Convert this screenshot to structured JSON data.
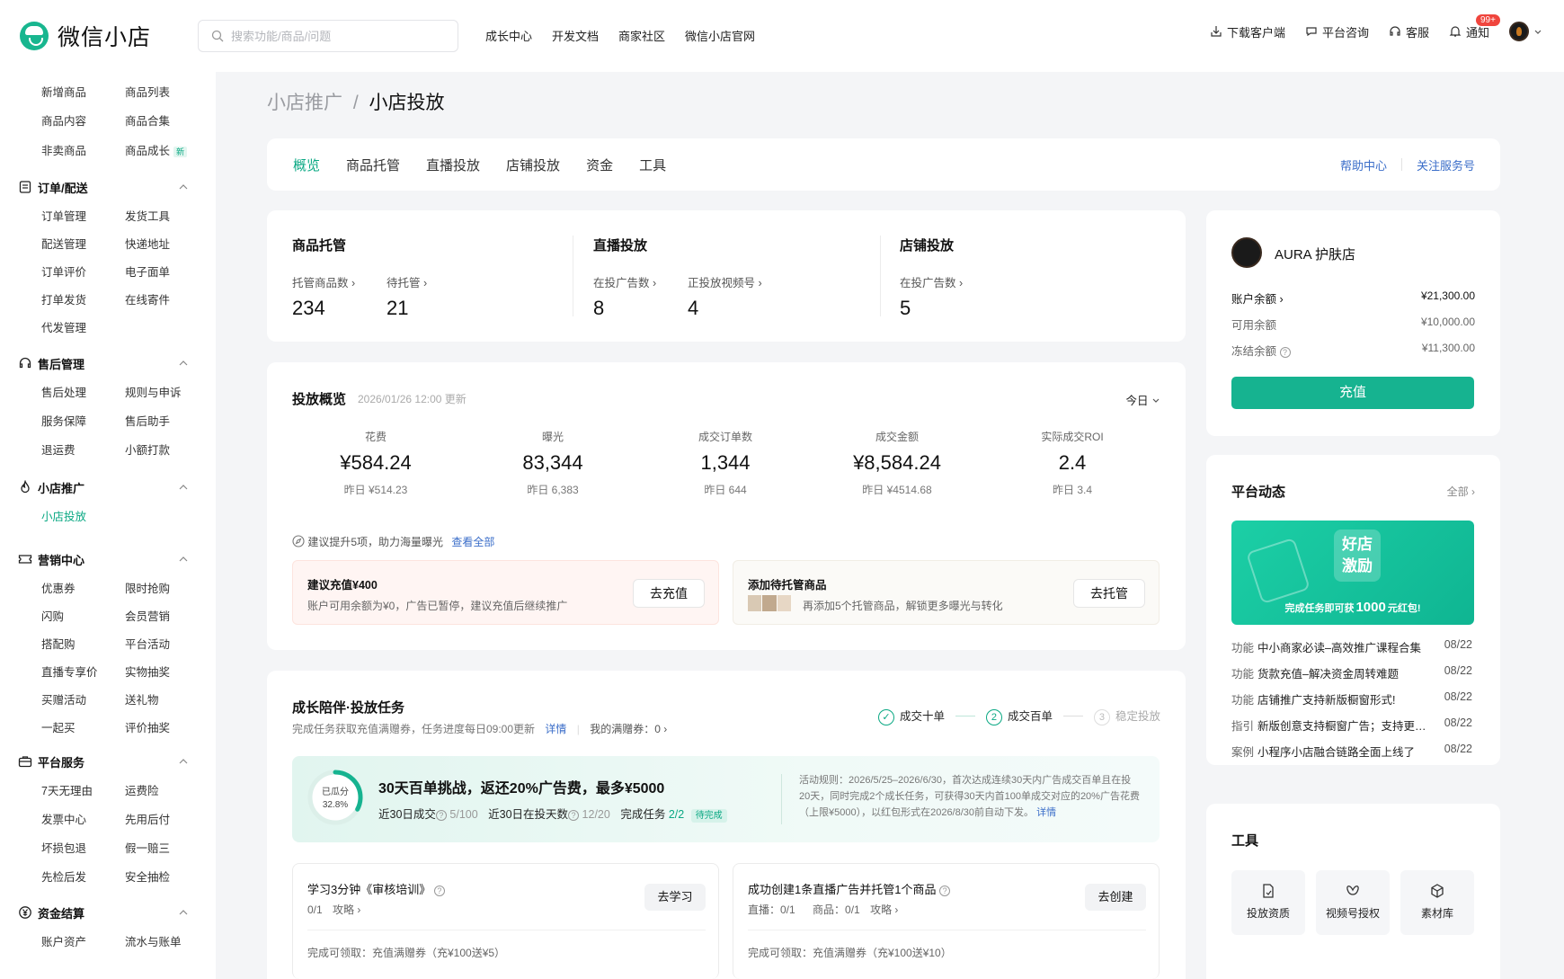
{
  "app": {
    "logo_text": "微信小店"
  },
  "search": {
    "placeholder": "搜索功能/商品/问题"
  },
  "topnav": [
    "成长中心",
    "开发文档",
    "商家社区",
    "微信小店官网"
  ],
  "topright": {
    "download": "下载客户端",
    "consult": "平台咨询",
    "service": "客服",
    "notify": "通知",
    "notify_badge": "99+"
  },
  "sidebar": {
    "top_items": [
      "新增商品",
      "商品列表",
      "商品内容",
      "商品合集",
      "非卖商品",
      "商品成长"
    ],
    "new_tag": "新",
    "sections": [
      {
        "title": "订单/配送",
        "items": [
          "订单管理",
          "发货工具",
          "配送管理",
          "快递地址",
          "订单评价",
          "电子面单",
          "打单发货",
          "在线寄件",
          "代发管理"
        ]
      },
      {
        "title": "售后管理",
        "items": [
          "售后处理",
          "规则与申诉",
          "服务保障",
          "售后助手",
          "退运费",
          "小额打款"
        ]
      },
      {
        "title": "小店推广",
        "items": [
          "小店投放"
        ]
      },
      {
        "title": "营销中心",
        "items": [
          "优惠券",
          "限时抢购",
          "闪购",
          "会员营销",
          "搭配购",
          "平台活动",
          "直播专享价",
          "实物抽奖",
          "买赠活动",
          "送礼物",
          "一起买",
          "评价抽奖"
        ]
      },
      {
        "title": "平台服务",
        "items": [
          "7天无理由",
          "运费险",
          "发票中心",
          "先用后付",
          "坏损包退",
          "假一赔三",
          "先检后发",
          "安全抽检"
        ]
      },
      {
        "title": "资金结算",
        "items": [
          "账户资产",
          "流水与账单"
        ]
      }
    ]
  },
  "breadcrumb": {
    "parent": "小店推广",
    "sep": "/",
    "current": "小店投放"
  },
  "tabs": [
    "概览",
    "商品托管",
    "直播投放",
    "店铺投放",
    "资金",
    "工具"
  ],
  "tab_links": {
    "help": "帮助中心",
    "follow": "关注服务号"
  },
  "stats": {
    "hosting": {
      "title": "商品托管",
      "a_label": "托管商品数",
      "a_value": "234",
      "b_label": "待托管",
      "b_value": "21"
    },
    "live": {
      "title": "直播投放",
      "a_label": "在投广告数",
      "a_value": "8",
      "b_label": "正投放视频号",
      "b_value": "4"
    },
    "shop": {
      "title": "店铺投放",
      "a_label": "在投广告数",
      "a_value": "5"
    }
  },
  "overview": {
    "title": "投放概览",
    "updated": "2026/01/26 12:00 更新",
    "range": "今日",
    "metrics": [
      {
        "label": "花费",
        "value": "¥584.24",
        "prev": "昨日 ¥514.23"
      },
      {
        "label": "曝光",
        "value": "83,344",
        "prev": "昨日 6,383"
      },
      {
        "label": "成交订单数",
        "value": "1,344",
        "prev": "昨日 644"
      },
      {
        "label": "成交金额",
        "value": "¥8,584.24",
        "prev": "昨日 ¥4514.68"
      },
      {
        "label": "实际成交ROI",
        "value": "2.4",
        "prev": "昨日 3.4"
      }
    ],
    "suggest_text": "建议提升5项，助力海量曝光",
    "suggest_link": "查看全部",
    "s1_title": "建议充值¥400",
    "s1_desc": "账户可用余额为¥0，广告已暂停，建议充值后继续推广",
    "s1_btn": "去充值",
    "s2_title": "添加待托管商品",
    "s2_desc": "再添加5个托管商品，解锁更多曝光与转化",
    "s2_btn": "去托管"
  },
  "growth": {
    "title": "成长陪伴·投放任务",
    "sub": "完成任务获取充值满赠券，任务进度每日09:00更新",
    "detail": "详情",
    "coupons": "我的满赠券：0",
    "steps": [
      {
        "num": "✓",
        "label": "成交十单"
      },
      {
        "num": "2",
        "label": "成交百单"
      },
      {
        "num": "3",
        "label": "稳定投放"
      }
    ],
    "ring_label": "已瓜分",
    "ring_value": "32.8%",
    "ring_fraction": 0.328,
    "challenge_title": "30天百单挑战，返还20%广告费，最多¥5000",
    "c_orders_label": "近30日成交",
    "c_orders": "5/100",
    "c_days_label": "近30日在投天数",
    "c_days": "12/20",
    "c_task_label": "完成任务",
    "c_task": "2/2",
    "c_status": "待完成",
    "rule": "活动规则：2026/5/25–2026/6/30，首次达成连续30天内广告成交百单且在投20天，同时完成2个成长任务，可获得30天内首100单成交对应的20%广告花费（上限¥5000），以红包形式在2026/8/30前自动下发。",
    "rule_link": "详情",
    "task1_title": "学习3分钟《审核培训》",
    "task1_progress": "0/1",
    "task1_guide": "攻略",
    "task1_btn": "去学习",
    "task1_reward": "完成可领取：充值满赠券（充¥100送¥5）",
    "task2_title": "成功创建1条直播广告并托管1个商品",
    "task2_live": "直播：0/1",
    "task2_goods": "商品：0/1",
    "task2_guide": "攻略",
    "task2_btn": "去创建",
    "task2_reward": "完成可领取：充值满赠券（充¥100送¥10）"
  },
  "account": {
    "shop": "AURA 护肤店",
    "balance_label": "账户余额",
    "balance": "¥21,300.00",
    "avail_label": "可用余额",
    "avail": "¥10,000.00",
    "frozen_label": "冻结余额",
    "frozen": "¥11,300.00",
    "recharge": "充值"
  },
  "news": {
    "title": "平台动态",
    "all": "全部",
    "banner_title1": "好店",
    "banner_title2": "激励",
    "banner_text_pre": "完成任务即可获",
    "banner_text_num": "1000",
    "banner_text_post": "元红包!",
    "items": [
      {
        "type": "功能",
        "title": "中小商家必读–高效推广课程合集",
        "date": "08/22"
      },
      {
        "type": "功能",
        "title": "货款充值–解决资金周转难题",
        "date": "08/22"
      },
      {
        "type": "功能",
        "title": "店铺推广支持新版橱窗形式!",
        "date": "08/22"
      },
      {
        "type": "指引",
        "title": "新版创意支持橱窗广告；支持更多样式",
        "date": "08/22"
      },
      {
        "type": "案例",
        "title": "小程序小店融合链路全面上线了",
        "date": "08/22"
      }
    ]
  },
  "tools": {
    "title": "工具",
    "items": [
      "投放资质",
      "视频号授权",
      "素材库"
    ]
  },
  "colors": {
    "accent": "#0aa883",
    "button": "#16b390",
    "link": "#3b6ec9"
  }
}
